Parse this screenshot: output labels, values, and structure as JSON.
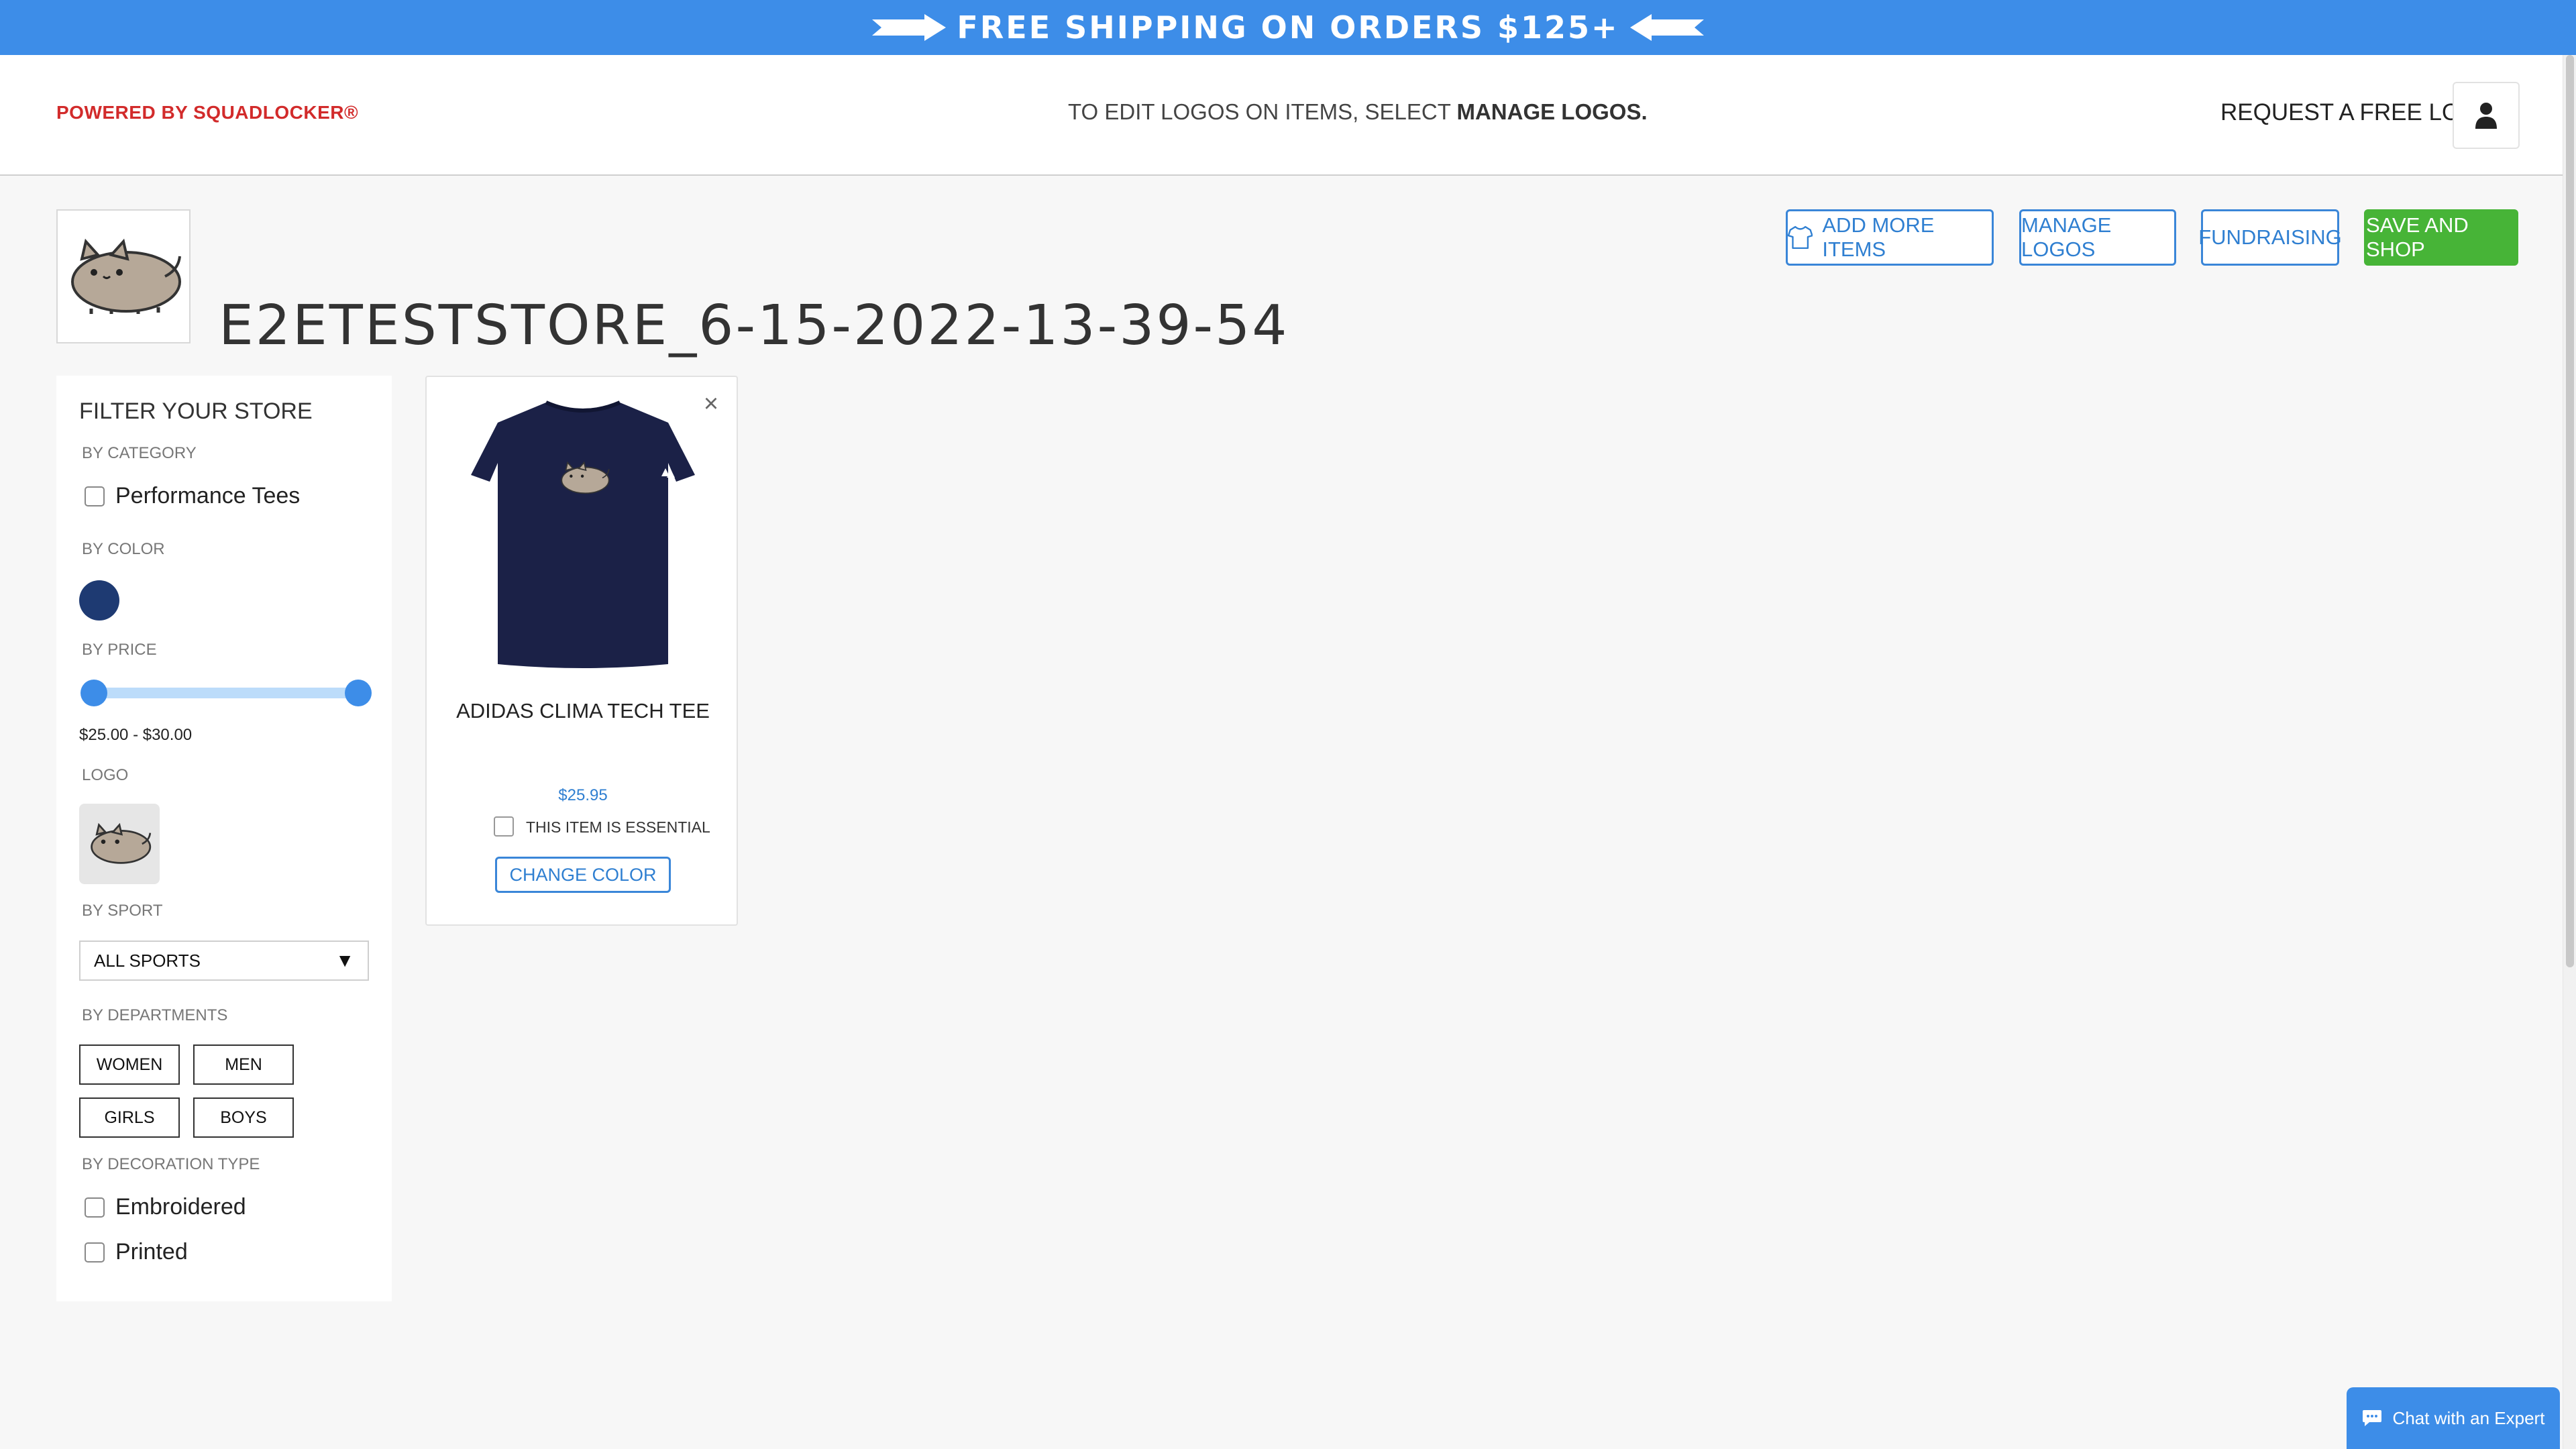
{
  "banner": {
    "text": "FREE SHIPPING ON ORDERS $125+",
    "color": "#3d8de8"
  },
  "header": {
    "powered_by": "POWERED BY SQUADLOCKER®",
    "edit_note_prefix": "TO EDIT LOGOS ON ITEMS, SELECT ",
    "edit_note_bold": "MANAGE LOGOS.",
    "request_logo": "REQUEST A FREE LOGO",
    "account_icon": "user-icon"
  },
  "store": {
    "title": "E2ETESTSTORE_6-15-2022-13-39-54",
    "logo_icon": "pusheen-cat-logo"
  },
  "actions": {
    "add_more_items": "ADD MORE ITEMS",
    "manage_logos": "MANAGE LOGOS",
    "fundraising": "FUNDRAISING",
    "save_and_shop": "SAVE AND SHOP",
    "accent": "#2f7fd1",
    "save_color": "#47b437"
  },
  "filters": {
    "title": "FILTER YOUR STORE",
    "category_label": "BY CATEGORY",
    "categories": [
      "Performance Tees"
    ],
    "color_label": "BY COLOR",
    "colors": [
      "#1e3a72"
    ],
    "price_label": "BY PRICE",
    "price_range": "$25.00 - $30.00",
    "price_slider": {
      "min_fraction": 0,
      "max_fraction": 1
    },
    "logo_label": "LOGO",
    "sport_label": "BY SPORT",
    "sport_selected": "ALL SPORTS",
    "departments_label": "BY DEPARTMENTS",
    "departments": [
      "WOMEN",
      "MEN",
      "GIRLS",
      "BOYS"
    ],
    "decoration_label": "BY DECORATION TYPE",
    "decorations": [
      "Embroidered",
      "Printed"
    ]
  },
  "product": {
    "name": "ADIDAS CLIMA TECH TEE",
    "price": "$25.95",
    "essential_label": "THIS ITEM IS ESSENTIAL",
    "change_color": "CHANGE COLOR",
    "close_icon": "close-icon",
    "shirt_color": "#1b2147"
  },
  "chat": {
    "label": "Chat with an Expert",
    "icon": "chat-bubble-icon"
  }
}
